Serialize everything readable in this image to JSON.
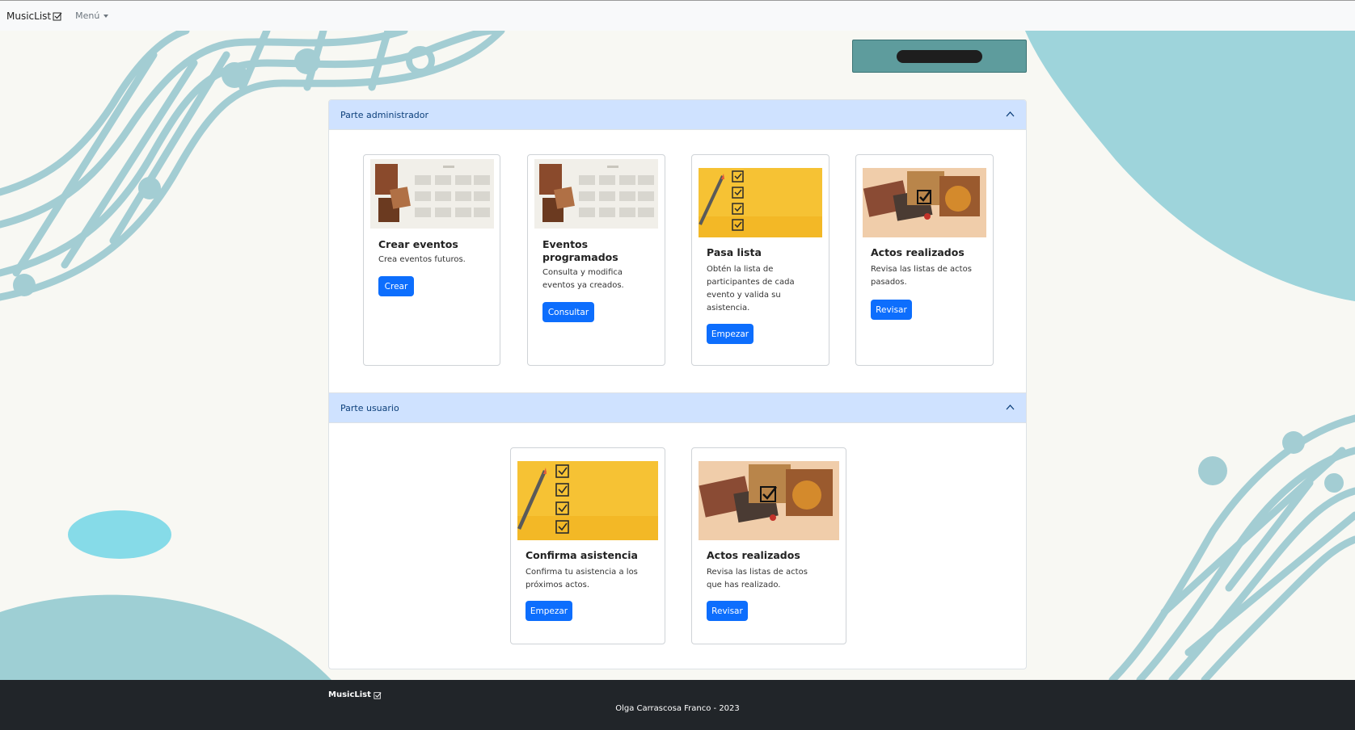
{
  "navbar": {
    "brand": "MusicList",
    "menu_label": "Menú"
  },
  "admin_section": {
    "title": "Parte administrador",
    "cards": [
      {
        "title": "Crear eventos",
        "text": "Crea eventos futuros.",
        "button": "Crear",
        "image": "calendar-image"
      },
      {
        "title": "Eventos programados",
        "text": "Consulta y modifica eventos ya creados.",
        "button": "Consultar",
        "image": "calendar-image"
      },
      {
        "title": "Pasa lista",
        "text": "Obtén la lista de participantes de cada evento y valida su asistencia.",
        "button": "Empezar",
        "image": "checklist-image"
      },
      {
        "title": "Actos realizados",
        "text": "Revisa las listas de actos pasados.",
        "button": "Revisar",
        "image": "instruments-image"
      }
    ]
  },
  "user_section": {
    "title": "Parte usuario",
    "cards": [
      {
        "title": "Confirma asistencia",
        "text": "Confirma tu asistencia a los próximos actos.",
        "button": "Empezar",
        "image": "checklist-image"
      },
      {
        "title": "Actos realizados",
        "text": "Revisa las listas de actos que has realizado.",
        "button": "Revisar",
        "image": "instruments-image"
      }
    ]
  },
  "footer": {
    "brand": "MusicList",
    "copyright": "Olga Carrascosa Franco - 2023"
  },
  "colors": {
    "accordion_header": "#cfe2ff",
    "primary_button": "#0d6efd",
    "footer_bg": "#212529",
    "decoration": "#9fcfd4"
  }
}
